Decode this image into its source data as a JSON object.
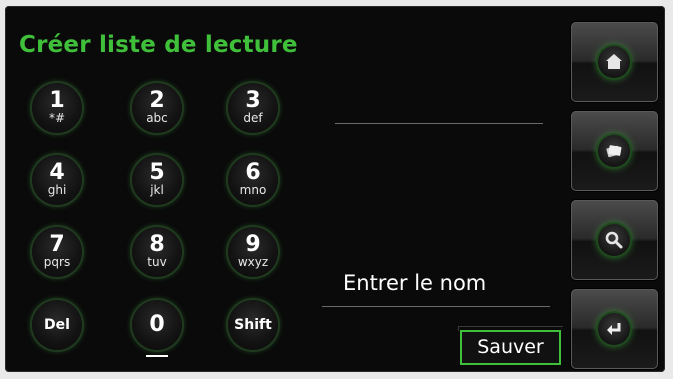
{
  "title": "Créer liste de lecture",
  "keypad": [
    {
      "digit": "1",
      "letters": "*#"
    },
    {
      "digit": "2",
      "letters": "abc"
    },
    {
      "digit": "3",
      "letters": "def"
    },
    {
      "digit": "4",
      "letters": "ghi"
    },
    {
      "digit": "5",
      "letters": "jkl"
    },
    {
      "digit": "6",
      "letters": "mno"
    },
    {
      "digit": "7",
      "letters": "pqrs"
    },
    {
      "digit": "8",
      "letters": "tuv"
    },
    {
      "digit": "9",
      "letters": "wxyz"
    }
  ],
  "del_label": "Del",
  "zero_digit": "0",
  "shift_label": "Shift",
  "entry_placeholder": "Entrer le nom",
  "save_label": "Sauver",
  "sidebar": {
    "icons": [
      "home-icon",
      "playlist-icon",
      "search-icon",
      "enter-icon"
    ]
  },
  "colors": {
    "accent": "#3fbf3a",
    "background": "#0a0a0a",
    "text": "#ffffff"
  }
}
